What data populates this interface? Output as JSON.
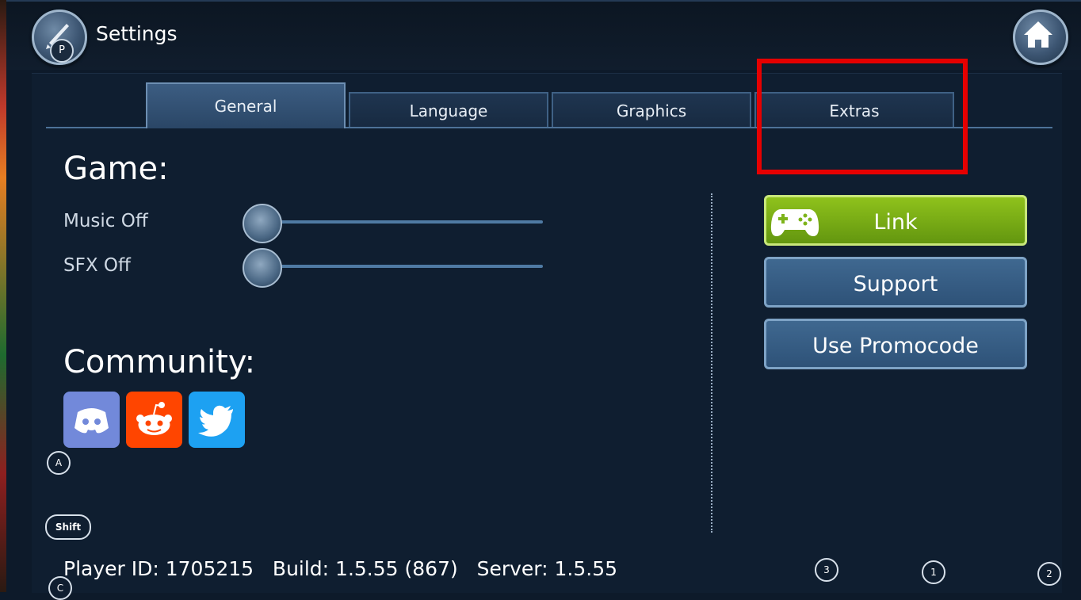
{
  "header": {
    "title": "Settings",
    "settings_badge": "P",
    "settings_icon": "brush-icon",
    "home_icon": "home-icon"
  },
  "tabs": [
    {
      "label": "General",
      "active": true
    },
    {
      "label": "Language",
      "active": false
    },
    {
      "label": "Graphics",
      "active": false
    },
    {
      "label": "Extras",
      "active": false
    }
  ],
  "game": {
    "title": "Game:",
    "music_label": "Music Off",
    "sfx_label": "SFX Off"
  },
  "community": {
    "title": "Community:",
    "links": [
      "discord-icon",
      "reddit-icon",
      "twitter-icon"
    ]
  },
  "actions": {
    "link_label": "Link",
    "support_label": "Support",
    "promo_label": "Use Promocode"
  },
  "hints": {
    "a": "A",
    "shift": "Shift",
    "c": "C",
    "three": "3",
    "one": "1",
    "two": "2"
  },
  "footer": {
    "info": "Player ID: 1705215   Build: 1.5.55 (867)   Server: 1.5.55"
  },
  "colors": {
    "background": "#0f1e30",
    "link_green": "#7db31a",
    "button_blue": "#3f6890",
    "highlight_red": "#e60000"
  }
}
